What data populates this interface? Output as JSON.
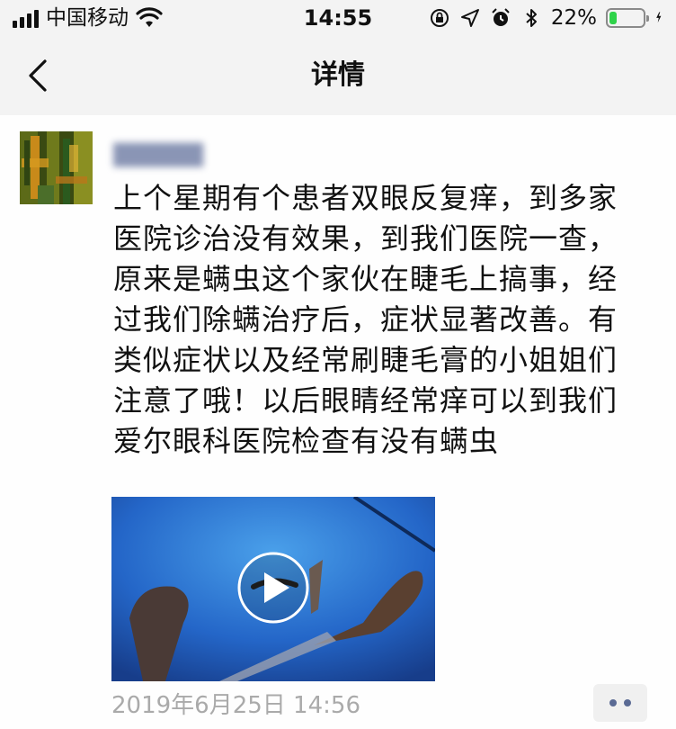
{
  "status_bar": {
    "carrier": "中国移动",
    "time": "14:55",
    "battery_percent": "22%",
    "battery_level": 0.22,
    "icons": [
      "signal-icon",
      "wifi-icon",
      "orientation-lock-icon",
      "location-icon",
      "alarm-icon",
      "bluetooth-icon",
      "battery-icon",
      "charging-icon"
    ]
  },
  "nav": {
    "title": "详情",
    "back_icon": "chevron-left-icon"
  },
  "post": {
    "username": "▇▇▇▇▇",
    "text": "上个星期有个患者双眼反复痒，到多家\n医院诊治没有效果，到我们医院一查，\n原来是螨虫这个家伙在睫毛上搞事，经\n过我们除螨治疗后，症状显著改善。有\n类似症状以及经常刷睫毛膏的小姐姐们\n注意了哦！以后眼睛经常痒可以到我们\n爱尔眼科医院检查有没有螨虫",
    "video_play_icon": "play-icon",
    "timestamp": "2019年6月25日 14:56",
    "more_icon": "more-dots-icon"
  },
  "colors": {
    "background": "#f3f3f3",
    "content": "#fefefe",
    "battery_fill": "#2fd34a",
    "timestamp": "#aaaaaa",
    "link_blue": "#5a6a94"
  }
}
